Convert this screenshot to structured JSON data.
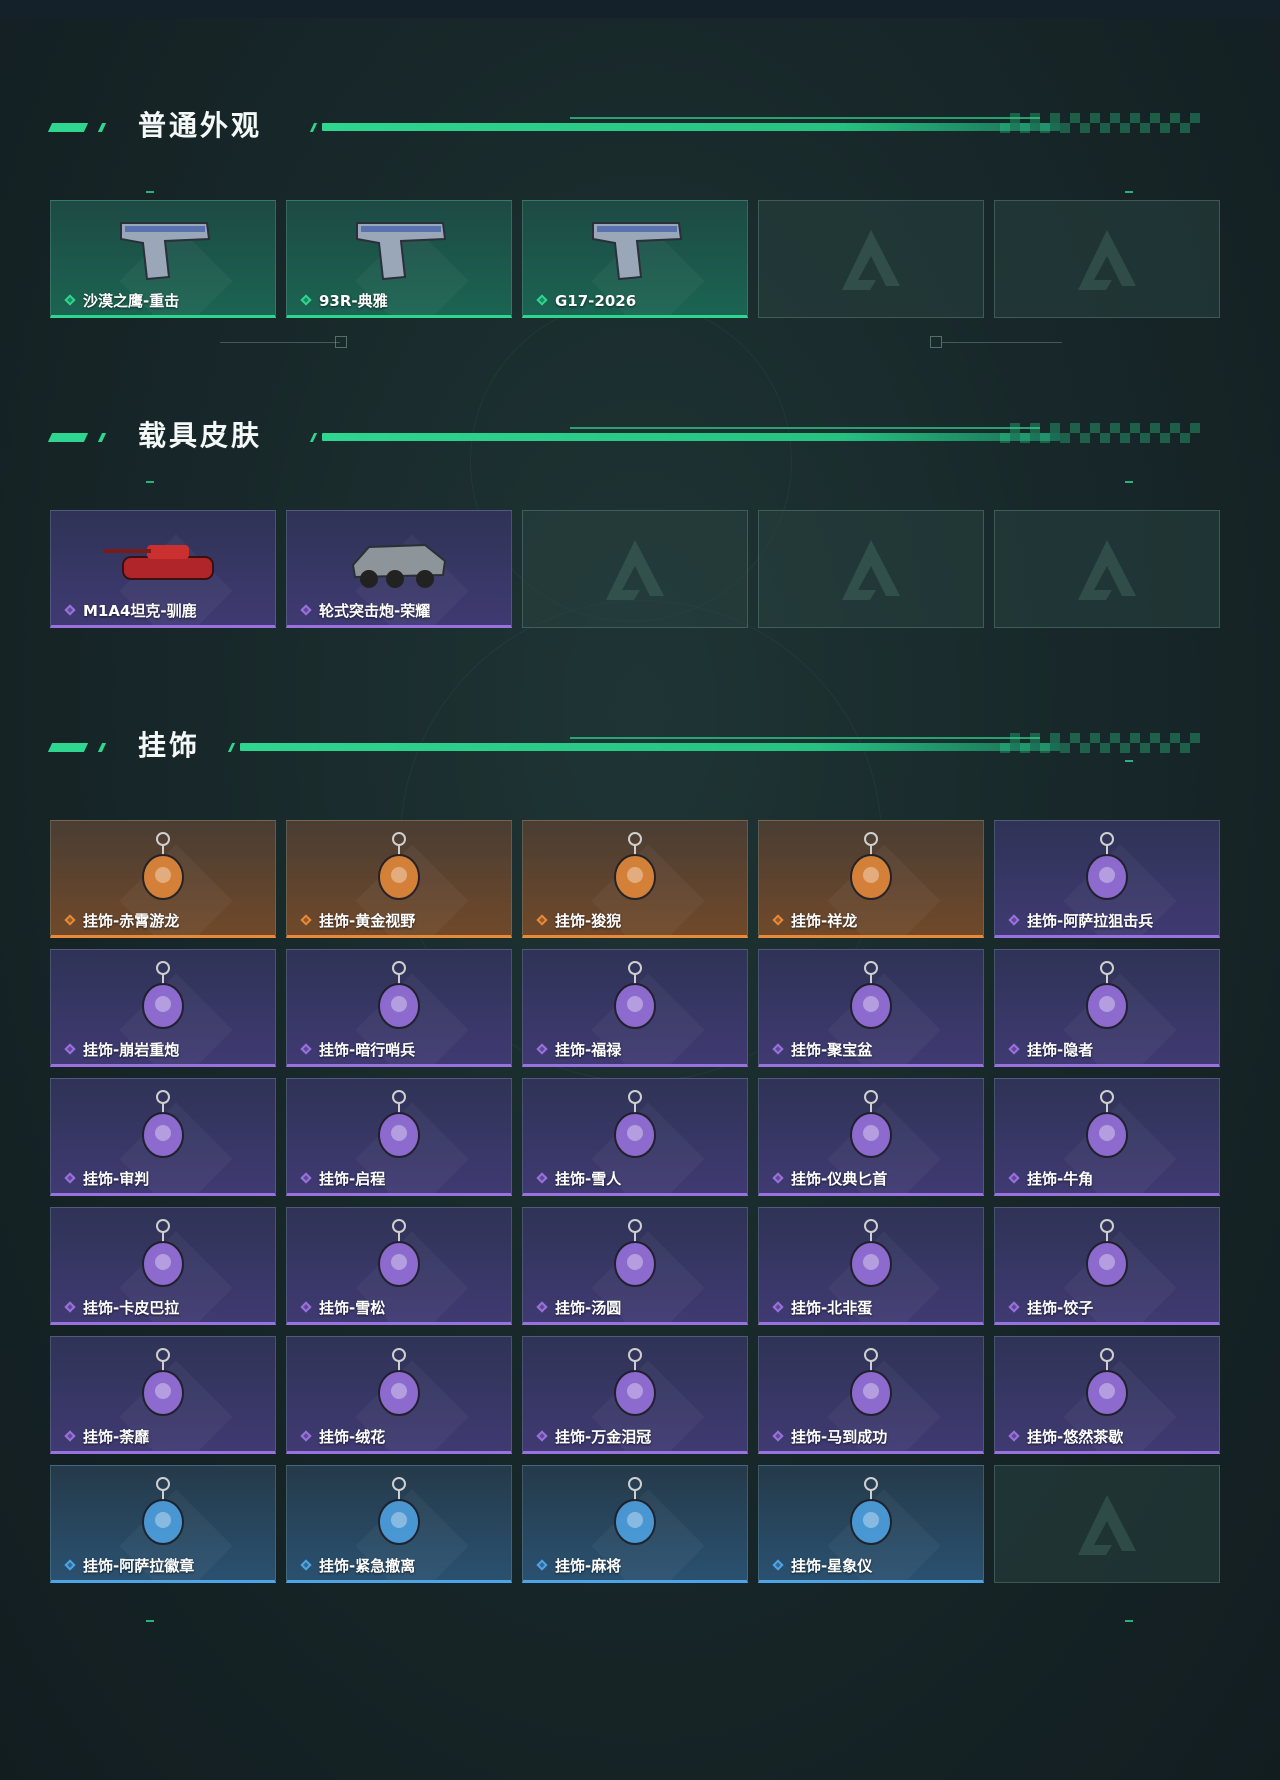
{
  "sections": {
    "normal": {
      "title": "普通外观",
      "items": [
        {
          "name": "沙漠之鹰-重击",
          "rarity": "green",
          "icon": "pistol-icon"
        },
        {
          "name": "93R-典雅",
          "rarity": "green",
          "icon": "pistol-icon"
        },
        {
          "name": "G17-2026",
          "rarity": "green",
          "icon": "pistol-icon"
        }
      ]
    },
    "vehicle": {
      "title": "载具皮肤",
      "items": [
        {
          "name": "M1A4坦克-驯鹿",
          "rarity": "purple",
          "icon": "tank-icon"
        },
        {
          "name": "轮式突击炮-荣耀",
          "rarity": "purple",
          "icon": "armored-car-icon"
        }
      ]
    },
    "charms": {
      "title": "挂饰",
      "items": [
        {
          "name": "挂饰-赤霄游龙",
          "rarity": "orange"
        },
        {
          "name": "挂饰-黄金视野",
          "rarity": "orange"
        },
        {
          "name": "挂饰-狻猊",
          "rarity": "orange"
        },
        {
          "name": "挂饰-祥龙",
          "rarity": "orange"
        },
        {
          "name": "挂饰-阿萨拉狙击兵",
          "rarity": "purple"
        },
        {
          "name": "挂饰-崩岩重炮",
          "rarity": "purple"
        },
        {
          "name": "挂饰-暗行哨兵",
          "rarity": "purple"
        },
        {
          "name": "挂饰-福禄",
          "rarity": "purple"
        },
        {
          "name": "挂饰-聚宝盆",
          "rarity": "purple"
        },
        {
          "name": "挂饰-隐者",
          "rarity": "purple"
        },
        {
          "name": "挂饰-审判",
          "rarity": "purple"
        },
        {
          "name": "挂饰-启程",
          "rarity": "purple"
        },
        {
          "name": "挂饰-雪人",
          "rarity": "purple"
        },
        {
          "name": "挂饰-仪典匕首",
          "rarity": "purple"
        },
        {
          "name": "挂饰-牛角",
          "rarity": "purple"
        },
        {
          "name": "挂饰-卡皮巴拉",
          "rarity": "purple"
        },
        {
          "name": "挂饰-雪松",
          "rarity": "purple"
        },
        {
          "name": "挂饰-汤圆",
          "rarity": "purple"
        },
        {
          "name": "挂饰-北非蛋",
          "rarity": "purple"
        },
        {
          "name": "挂饰-饺子",
          "rarity": "purple"
        },
        {
          "name": "挂饰-荼靡",
          "rarity": "purple"
        },
        {
          "name": "挂饰-绒花",
          "rarity": "purple"
        },
        {
          "name": "挂饰-万金泪冠",
          "rarity": "purple"
        },
        {
          "name": "挂饰-马到成功",
          "rarity": "purple"
        },
        {
          "name": "挂饰-悠然茶歇",
          "rarity": "purple"
        },
        {
          "name": "挂饰-阿萨拉徽章",
          "rarity": "blue"
        },
        {
          "name": "挂饰-紧急撤离",
          "rarity": "blue"
        },
        {
          "name": "挂饰-麻将",
          "rarity": "blue"
        },
        {
          "name": "挂饰-星象仪",
          "rarity": "blue"
        }
      ]
    }
  },
  "colors": {
    "accent": "#2ed68f",
    "green": "#2ed68f",
    "purple": "#9a72e0",
    "orange": "#e88a3a",
    "blue": "#4ea4e6"
  }
}
